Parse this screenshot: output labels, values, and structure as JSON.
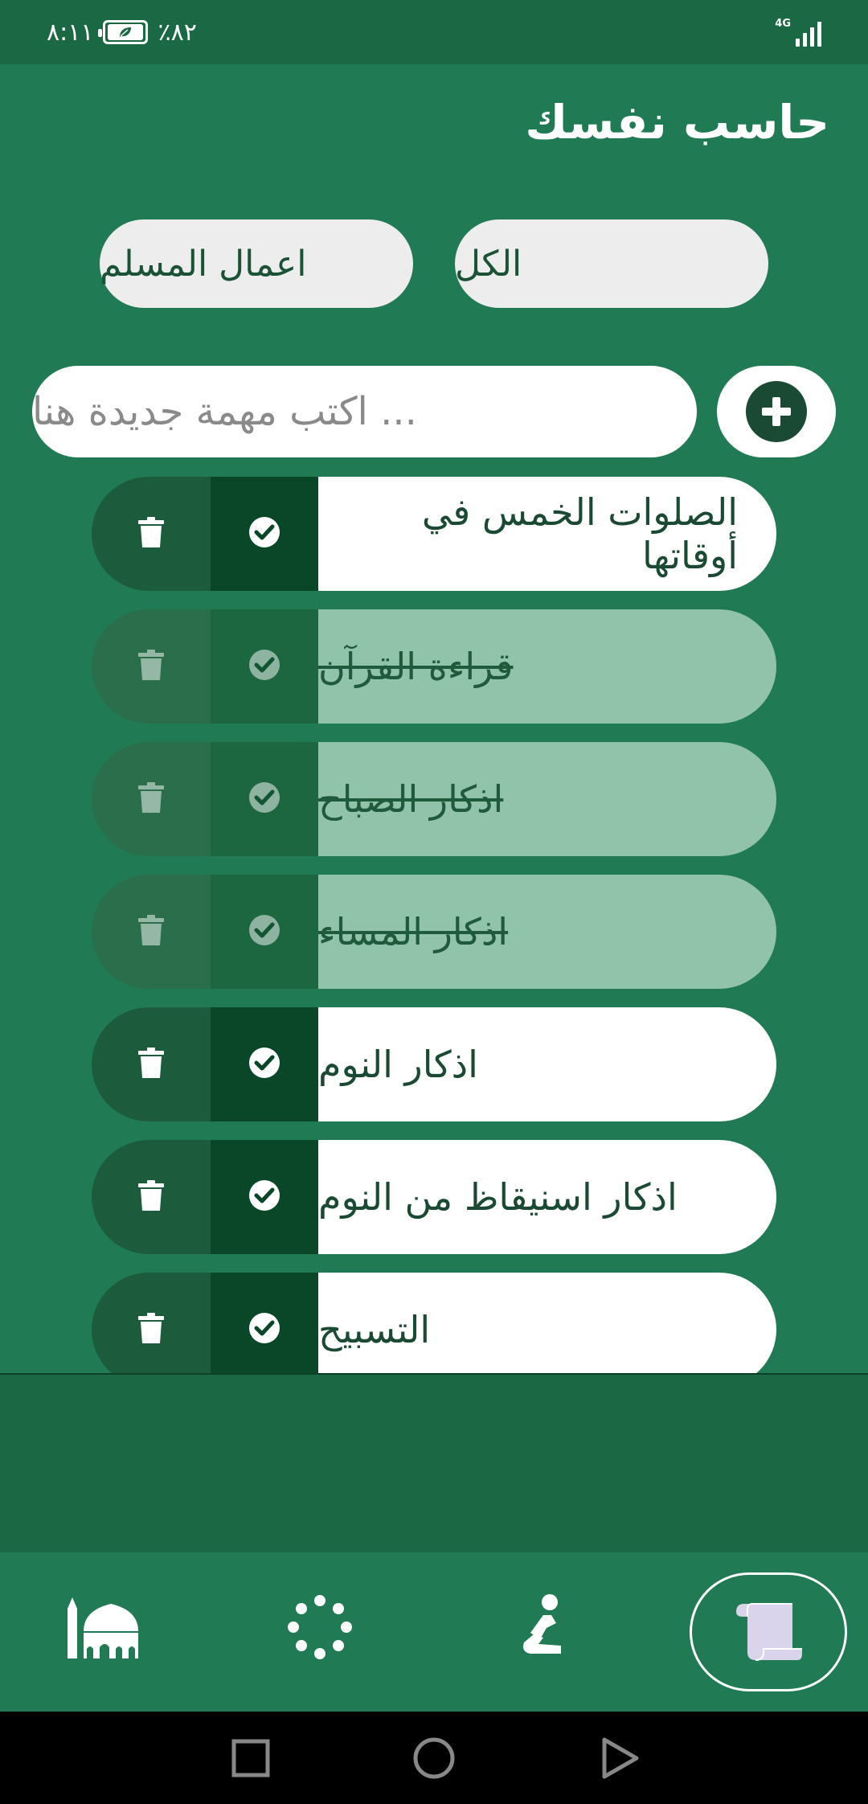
{
  "status_bar": {
    "time": "٨:١١",
    "battery_percent": "٪٨٢",
    "network": "4G",
    "signal_bars": 4
  },
  "header": {
    "title": "حاسب نفسك"
  },
  "filters": {
    "all_label": "الكل",
    "muslim_deeds_label": "اعمال المسلم"
  },
  "new_task": {
    "placeholder": "... اكتب مهمة جديدة هنا",
    "add_icon": "plus-circle-icon"
  },
  "tasks": [
    {
      "label": "الصلوات الخمس في أوقاتها",
      "done": false
    },
    {
      "label": "قراءة القرآن",
      "done": true
    },
    {
      "label": "اذكار الصباح",
      "done": true
    },
    {
      "label": "اذكار المساء",
      "done": true
    },
    {
      "label": "اذكار النوم",
      "done": false
    },
    {
      "label": "اذكار اسنيقاظ من النوم",
      "done": false
    },
    {
      "label": "التسبيح",
      "done": false
    }
  ],
  "bottom_nav": {
    "items": [
      {
        "icon": "scroll-icon",
        "active": true
      },
      {
        "icon": "prayer-icon",
        "active": false
      },
      {
        "icon": "tasbih-icon",
        "active": false
      },
      {
        "icon": "mosque-icon",
        "active": false
      }
    ]
  },
  "colors": {
    "background": "#207b54",
    "dark_green": "#0a4628",
    "done_row": "#91c3aa"
  }
}
